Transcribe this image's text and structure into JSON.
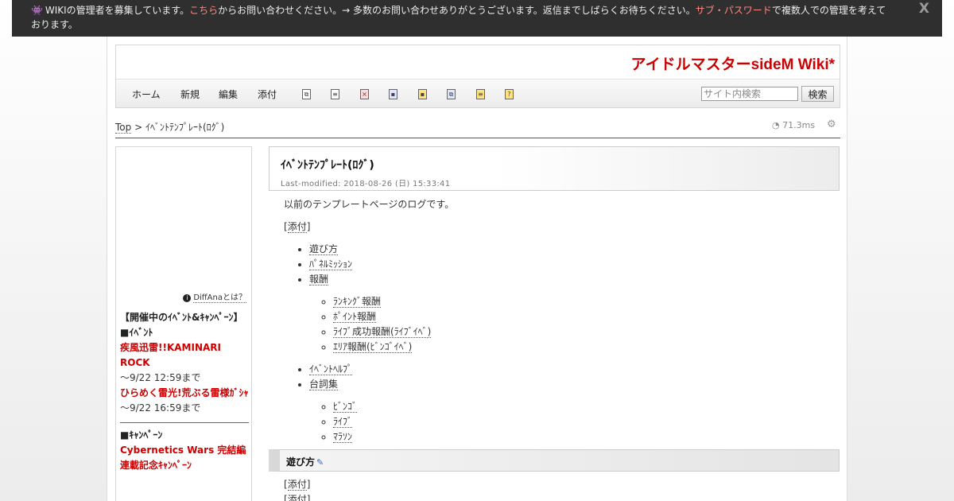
{
  "notice": {
    "text1": "WIKIの管理者を募集しています。",
    "link1": "こちら",
    "text2": "からお問い合わせください。→ 多数のお問い合わせありがとうございます。返信までしばらくお待ちください。",
    "link2": "サブ・パスワード",
    "text3": "で複数人での管理を考えております。",
    "close": "X"
  },
  "site": {
    "title": "アイドルマスターsideM Wiki*"
  },
  "menu": {
    "home": "ホーム",
    "new": "新規",
    "edit": "編集",
    "attach": "添付"
  },
  "toolbar_icons": [
    "copy-icon",
    "diff-icon",
    "delete-icon",
    "backup-icon",
    "freeze-icon",
    "rename-icon",
    "page-list-icon",
    "help-icon"
  ],
  "search": {
    "placeholder": "サイト内検索",
    "button": "検索"
  },
  "breadcrumb": {
    "top": "Top",
    "separator": ">",
    "current": "ｲﾍﾞﾝﾄﾃﾝﾌﾟﾚｰﾄ(ﾛｸﾞ)"
  },
  "timing": "71.3ms",
  "sidebar": {
    "diffana": "DiffAnaとは？",
    "heading": "【開催中のｲﾍﾞﾝﾄ&ｷｬﾝﾍﾟｰﾝ】",
    "event_label": "■ｲﾍﾞﾝﾄ",
    "event1": "疾風迅雷!!KAMINARI ROCK",
    "event1_date": "～9/22 12:59まで",
    "event2": "ひらめく雷光!荒ぶる雷様ｶﾞｼｬ",
    "event2_date": "～9/22 16:59まで",
    "campaign_label": "■ｷｬﾝﾍﾟｰﾝ",
    "campaign1": "Cybernetics Wars 完結編連載記念ｷｬﾝﾍﾟｰﾝ"
  },
  "main": {
    "title": "ｲﾍﾞﾝﾄﾃﾝﾌﾟﾚｰﾄ(ﾛｸﾞ)",
    "last_modified": "Last-modified: 2018-08-26 (日) 15:33:41",
    "intro": "以前のテンプレートページのログです。",
    "attach_open": "[",
    "attach": "添付",
    "attach_close": "]",
    "toc": {
      "item1": "遊び方",
      "item2": "ﾊﾟﾈﾙﾐｯｼｮﾝ",
      "item3": "報酬",
      "item3_children": [
        "ﾗﾝｷﾝｸﾞ報酬",
        "ﾎﾟｲﾝﾄ報酬",
        "ﾗｲﾌﾞ成功報酬(ﾗｲﾌﾞｲﾍﾞ)",
        "ｴﾘｱ報酬(ﾋﾞﾝｺﾞｲﾍﾞ)"
      ],
      "item4": "ｲﾍﾞﾝﾄﾍﾙﾌﾟ",
      "item5": "台詞集",
      "item5_children": [
        "ﾋﾞﾝｺﾞ",
        "ﾗｲﾌﾞ",
        "ﾏﾗｿﾝ"
      ]
    },
    "section1_heading": "遊び方",
    "section1_attach1": "添付",
    "section1_attach2": "添付"
  }
}
